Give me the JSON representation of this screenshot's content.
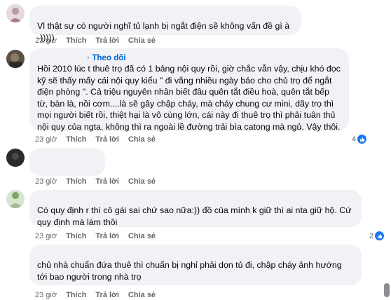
{
  "comments": [
    {
      "text": "Vl thật sự có người nghĩ tủ lạnh bị ngắt điện sẽ không vấn đề gì à -)))))",
      "time": "23 giờ",
      "like": "Thích",
      "reply": "Trả lời",
      "share": "Chia sẻ"
    },
    {
      "follow": "Theo dõi",
      "text": "Hồi 2010 lúc t thuê trọ đã có 1 bảng nội quy rồi, giờ chắc vẫn vậy, chịu khó đọc kỹ sẽ thấy mấy cái nội quy kiểu \" đi vắng nhiều ngày báo cho chủ trọ để ngắt điện phòng \". Cả triệu nguyên nhân biết đâu quên tắt điều hoà, quên tắt bếp từ, bàn là, nồi cơm....là sẽ gây chập cháy, mà cháy chung cư mini, dãy trọ thì mọi người biết rồi, thiệt hại là vô cùng lớn, cái này đi thuê trọ thì phải tuân thủ nội quy của ngta, không thì ra ngoài lề đường trải bìa catong mà ngủ. Vậy thôi.",
      "time": "23 giờ",
      "like": "Thích",
      "reply": "Trả lời",
      "share": "Chia sẻ",
      "reactions": "4"
    },
    {
      "text": "",
      "time": "23 giờ",
      "like": "Thích",
      "reply": "Trả lời",
      "share": "Chia sẻ"
    },
    {
      "text": "Có quy định r thì cô gái sai chứ sao nữa:)) đồ của mình k giữ thì ai nta giữ hộ. Cứ quy định mà làm thôi",
      "time": "23 giờ",
      "like": "Thích",
      "reply": "Trả lời",
      "share": "Chia sẻ",
      "reactions": "2"
    },
    {
      "text": "chủ nhà chuẩn đứa thuê thì chuẩn bị nghỉ phải dọn tủ đi, chập cháy ảnh hướng tới bao người trong nhà trọ",
      "time": "23 giờ",
      "like": "Thích",
      "reply": "Trả lời",
      "share": "Chia sẻ"
    }
  ],
  "icons": {
    "like": "like-thumb-icon",
    "avatar": "avatar"
  },
  "colors": {
    "bubble": "#f0f2f5",
    "link": "#0064d1",
    "meta": "#65676b",
    "like_badge": "#1877f2"
  }
}
